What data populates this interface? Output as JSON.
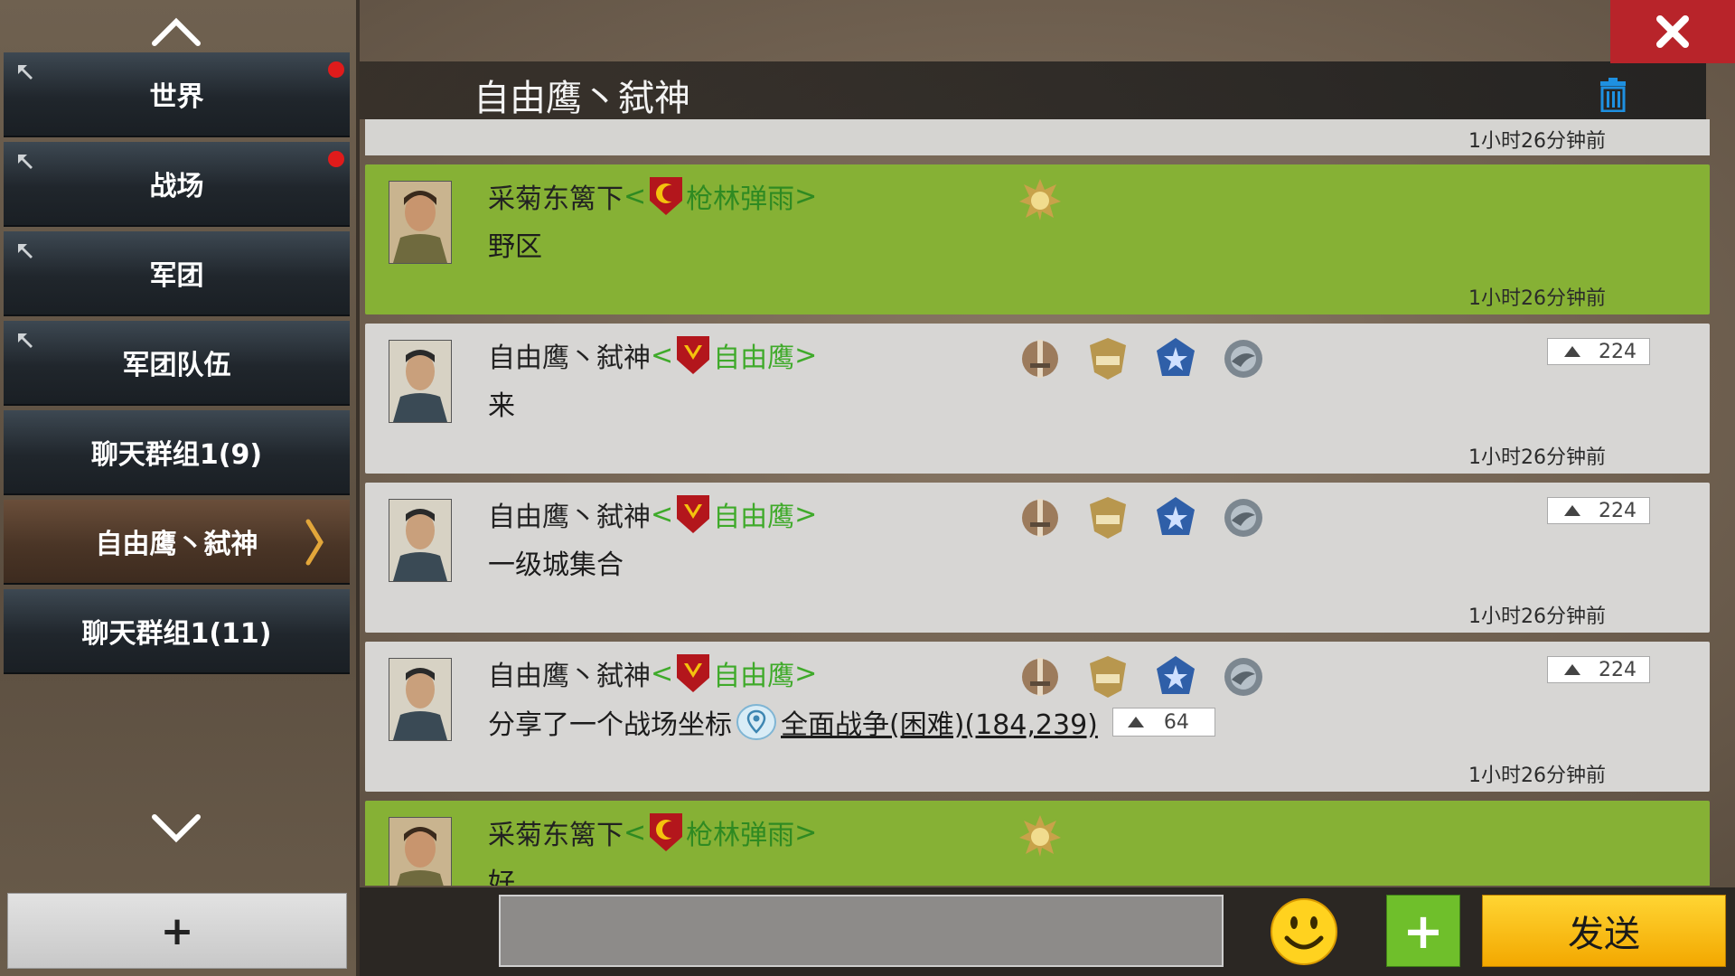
{
  "sidebar": {
    "tabs": [
      {
        "label": "世界",
        "pinned": true,
        "unread": true
      },
      {
        "label": "战场",
        "pinned": true,
        "unread": true
      },
      {
        "label": "军团",
        "pinned": true,
        "unread": false
      },
      {
        "label": "军团队伍",
        "pinned": true,
        "unread": false
      },
      {
        "label": "聊天群组1(9)",
        "pinned": false,
        "unread": false
      },
      {
        "label": "自由鹰丶弑神",
        "pinned": false,
        "unread": false,
        "active": true
      },
      {
        "label": "聊天群组1(11)",
        "pinned": false,
        "unread": false
      }
    ],
    "add_label": "+"
  },
  "header": {
    "title": "自由鹰丶弑神"
  },
  "messages": [
    {
      "time": "1小时26分钟前"
    },
    {
      "style": "green",
      "player": "采菊东篱下",
      "guild": "枪林弹雨",
      "text": "野区",
      "time": "1小时26分钟前",
      "medals": [
        "sun-medal-icon"
      ]
    },
    {
      "style": "grey",
      "player": "自由鹰丶弑神",
      "guild": "自由鹰",
      "text": "来",
      "time": "1小时26分钟前",
      "power": "224",
      "medals": [
        "sword-medal-icon",
        "eagle-medal-icon",
        "star-medal-icon",
        "wing-medal-icon"
      ]
    },
    {
      "style": "grey",
      "player": "自由鹰丶弑神",
      "guild": "自由鹰",
      "text": "一级城集合",
      "time": "1小时26分钟前",
      "power": "224",
      "medals": [
        "sword-medal-icon",
        "eagle-medal-icon",
        "star-medal-icon",
        "wing-medal-icon"
      ]
    },
    {
      "style": "grey",
      "player": "自由鹰丶弑神",
      "guild": "自由鹰",
      "text": "分享了一个战场坐标",
      "link": "全面战争(困难)(184,239)",
      "link_power": "64",
      "time": "1小时26分钟前",
      "power": "224",
      "medals": [
        "sword-medal-icon",
        "eagle-medal-icon",
        "star-medal-icon",
        "wing-medal-icon"
      ]
    },
    {
      "style": "green",
      "player": "采菊东篱下",
      "guild": "枪林弹雨",
      "text": "好",
      "medals": [
        "sun-medal-icon"
      ]
    }
  ],
  "chevrons": {
    "open": "<",
    "close": ">"
  },
  "bottom": {
    "send_label": "发送",
    "plus_label": "+"
  },
  "colors": {
    "green_row": "#86b135",
    "grey_row": "#d7d6d4",
    "guild_text": "#3faa2a",
    "close_bg": "#b8242a",
    "send_bg": "#ffc21a"
  }
}
